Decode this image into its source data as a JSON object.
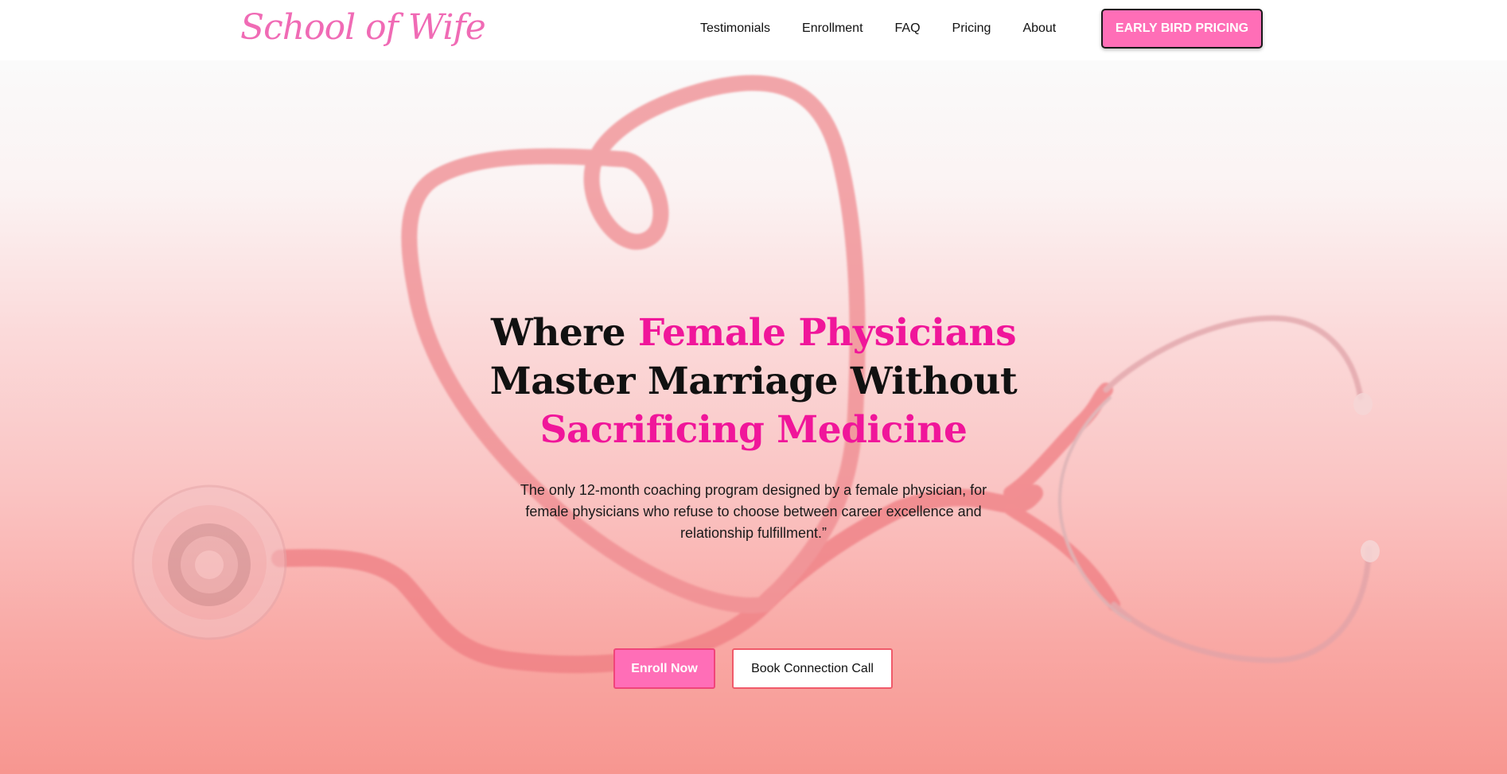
{
  "brand": {
    "logo_text": "School of Wife",
    "accent": "#f0169a",
    "button_pink": "#ff6eb7"
  },
  "nav": {
    "items": [
      {
        "label": "Testimonials"
      },
      {
        "label": "Enrollment"
      },
      {
        "label": "FAQ"
      },
      {
        "label": "Pricing"
      },
      {
        "label": "About"
      }
    ],
    "cta_label": "EARLY BIRD PRICING"
  },
  "hero": {
    "background_icon": "stethoscope-heart-image",
    "headline": {
      "part1": "Where ",
      "part2": "Female Physicians",
      "part3": "Master Marriage Without",
      "part4": "Sacrificing Medicine"
    },
    "subtext": "The only 12-month coaching program designed by a female physician, for female physicians who refuse to choose between career excellence and relationship fulfillment.”",
    "primary_button": "Enroll Now",
    "secondary_button": "Book Connection Call"
  }
}
